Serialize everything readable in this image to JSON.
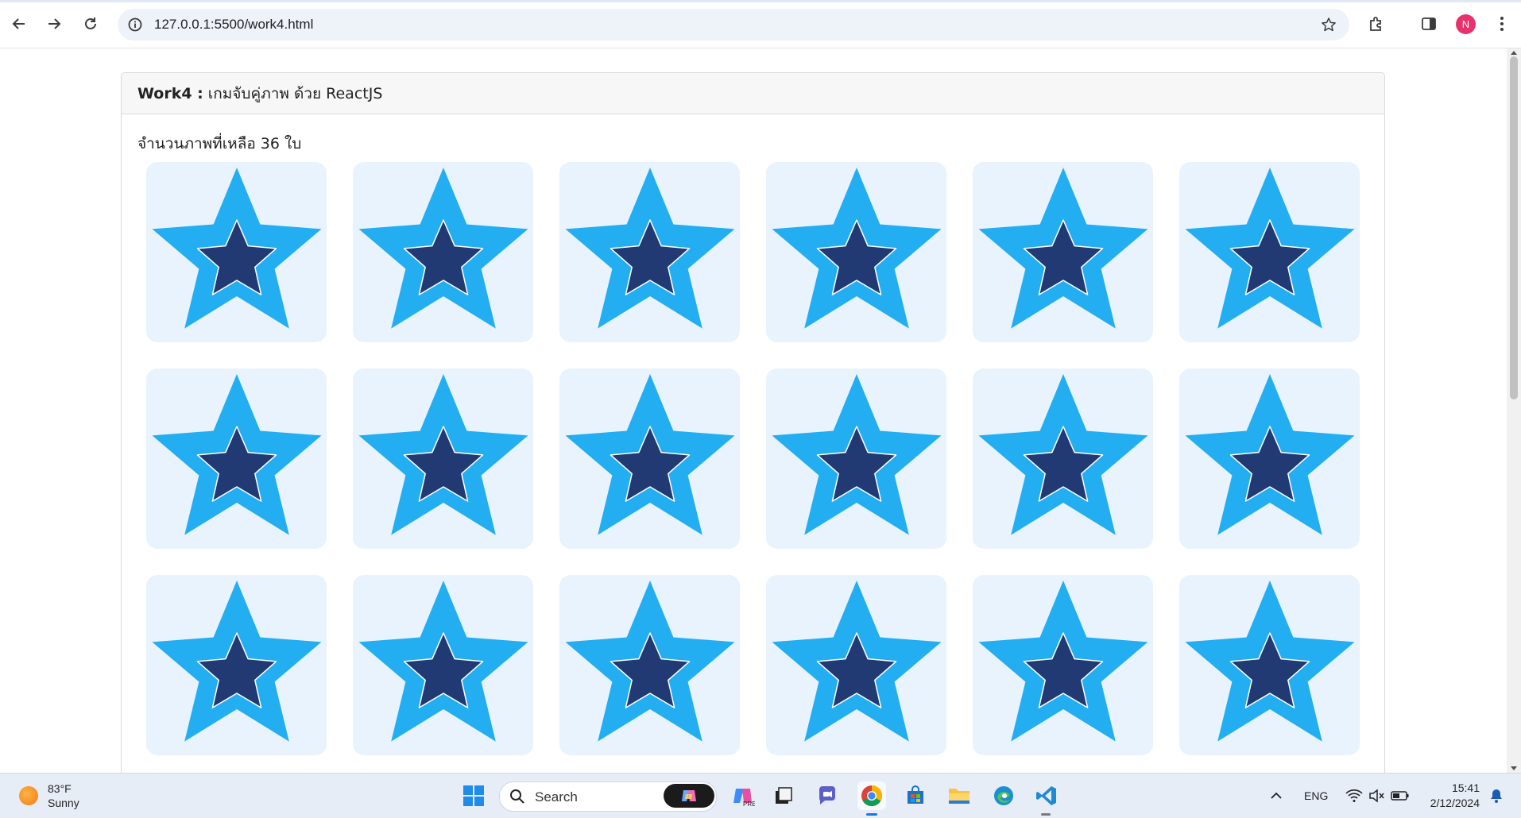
{
  "browser": {
    "url": "127.0.0.1:5500/work4.html",
    "profile_initial": "N"
  },
  "card": {
    "title_bold": "Work4 :",
    "title_rest": "เกมจับคู่ภาพ ด้วย ReactJS",
    "remaining_text": "จำนวนภาพที่เหลือ 36 ใบ"
  },
  "tiles": [
    "star",
    "star",
    "star",
    "star",
    "star",
    "star",
    "star",
    "star",
    "star",
    "star",
    "star",
    "star",
    "star",
    "star",
    "star",
    "star",
    "star",
    "star"
  ],
  "colors": {
    "tile_bg": "#e8f3fd",
    "outer_star": "#23aef2",
    "inner_star": "#223a73",
    "inner_star_stroke": "#ffffff"
  },
  "taskbar": {
    "weather_temp": "83°F",
    "weather_cond": "Sunny",
    "search_label": "Search",
    "language": "ENG",
    "time": "15:41",
    "date": "2/12/2024"
  }
}
